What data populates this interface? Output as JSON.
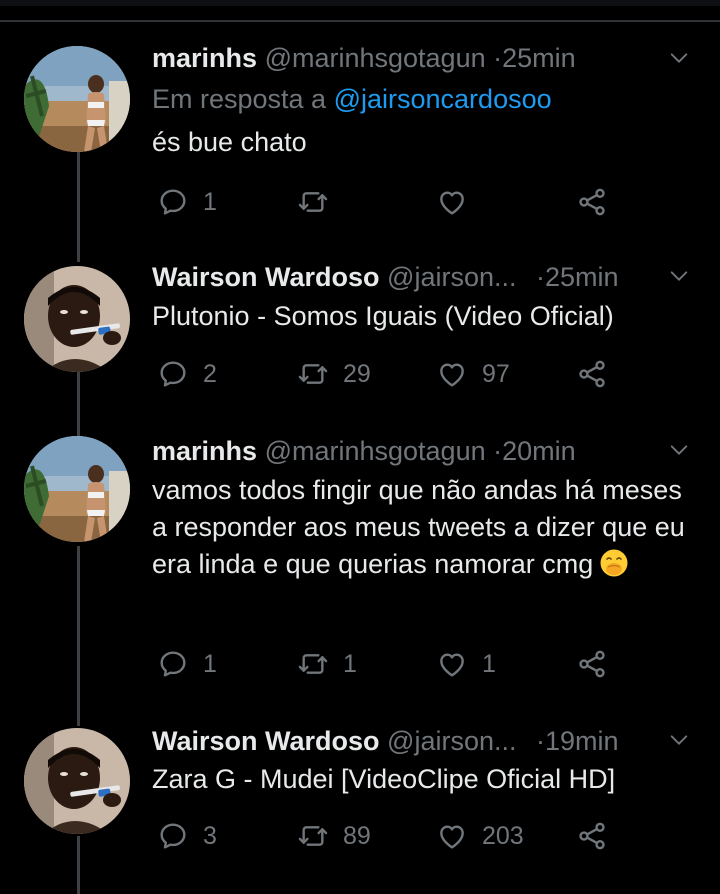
{
  "tweets": [
    {
      "name": "marinhs",
      "handle": "@marinhsgotagun",
      "separator": "·",
      "time": "25min",
      "reply_prefix": "Em resposta a",
      "reply_to": "@jairsoncardosoo",
      "text": "és bue chato",
      "replies": "1",
      "retweets": "",
      "likes": ""
    },
    {
      "name": "Wairson Wardoso",
      "handle": "@jairson...",
      "separator": "·",
      "time": "25min",
      "text": "Plutonio - Somos Iguais (Video Oficial)",
      "replies": "2",
      "retweets": "29",
      "likes": "97"
    },
    {
      "name": "marinhs",
      "handle": "@marinhsgotagun",
      "separator": "·",
      "time": "20min",
      "text": "vamos todos fingir que não andas há meses a responder aos meus tweets a dizer que eu era linda e que querias namorar cmg",
      "emoji": "face-with-hand-over-mouth",
      "replies": "1",
      "retweets": "1",
      "likes": "1"
    },
    {
      "name": "Wairson Wardoso",
      "handle": "@jairson...",
      "separator": "·",
      "time": "19min",
      "text": "Zara G - Mudei [VideoClipe Oficial HD]",
      "replies": "3",
      "retweets": "89",
      "likes": "203"
    }
  ],
  "icons": {
    "reply": "speech-bubble-icon",
    "retweet": "retweet-icon",
    "like": "heart-icon",
    "share": "share-icon",
    "menu": "chevron-down-icon"
  },
  "colors": {
    "background": "#000000",
    "text": "#e7e9ea",
    "muted": "#71767b",
    "link": "#1d9bf0",
    "thread_line": "#3d4145"
  }
}
